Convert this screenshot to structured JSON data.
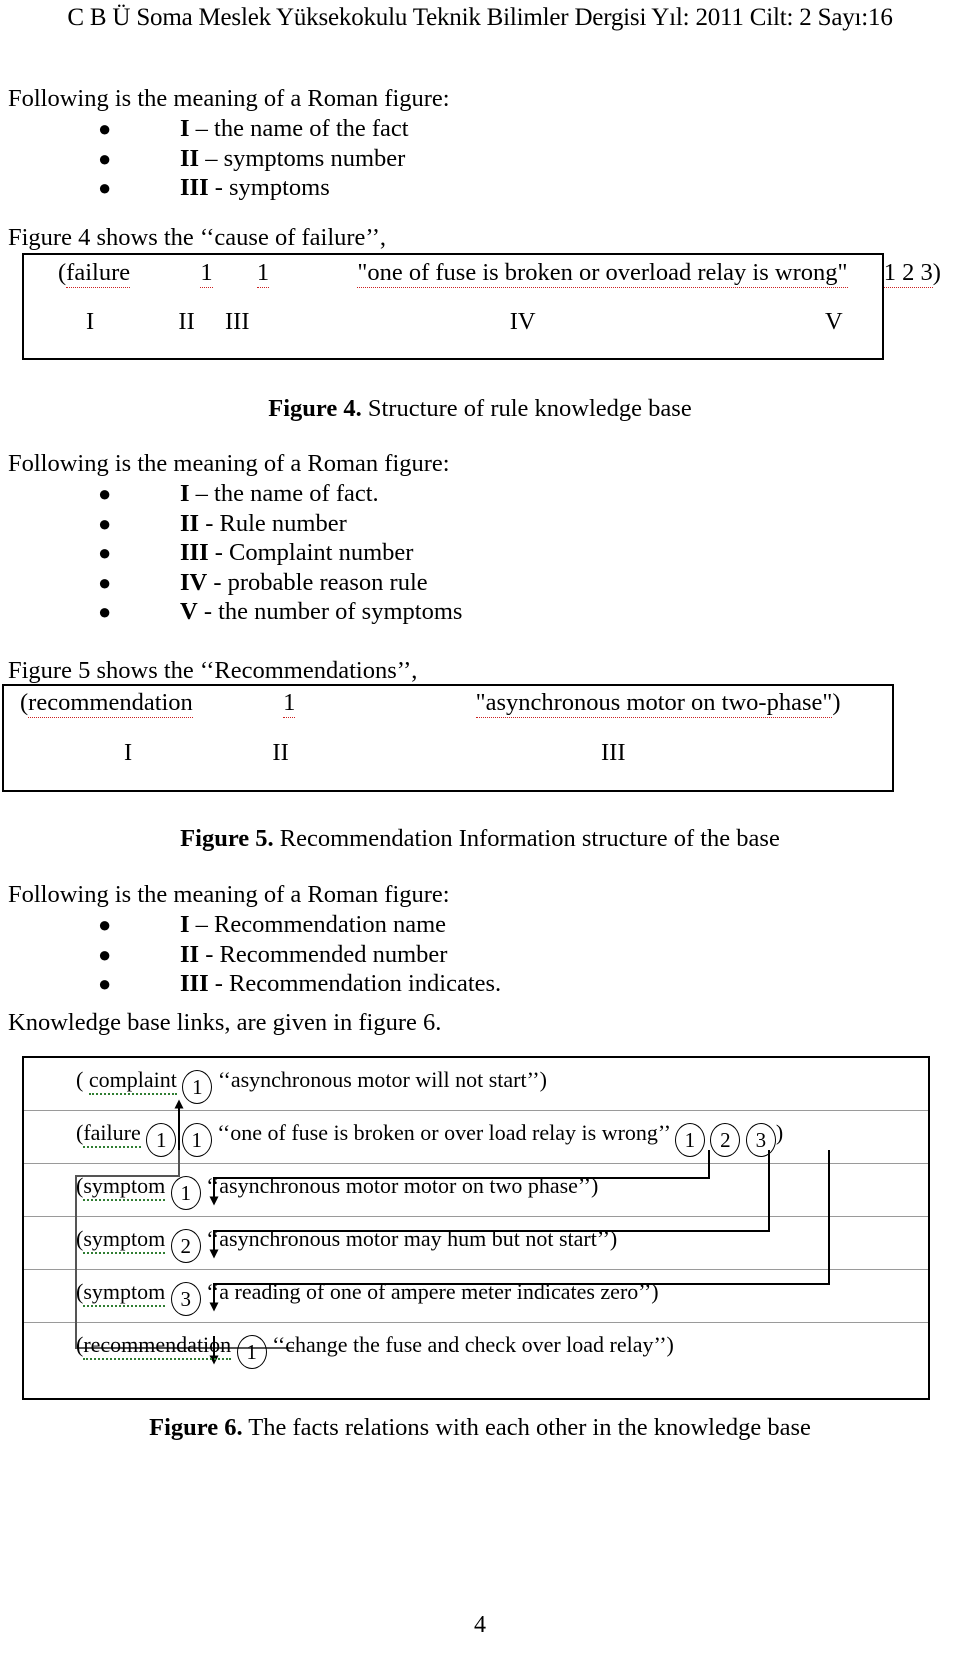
{
  "header": {
    "running_head": "C B Ü Soma Meslek Yüksekokulu Teknik Bilimler Dergisi Yıl: 2011 Cilt: 2 Sayı:16"
  },
  "section_fig4": {
    "intro": "Following is the meaning of a Roman figure:",
    "bullets": [
      {
        "roman": "I",
        "text": " – the name of the fact"
      },
      {
        "roman": "II",
        "text": " – symptoms number"
      },
      {
        "roman": "III",
        "text": " - symptoms"
      }
    ],
    "lead_in": "Figure 4 shows the ‘‘cause of failure’’,",
    "box": {
      "open_paren": "(",
      "fact_name": "failure",
      "rule_number": "1",
      "complaint_number": "1",
      "quoted": "\"one of fuse is broken or overload relay is wrong\"",
      "symptom_numbers": "1 2 3",
      "close_paren": ")",
      "roman_labels": [
        "I",
        "II",
        "III",
        "IV",
        "V"
      ]
    },
    "caption_bold": "Figure 4.",
    "caption_rest": " Structure of rule knowledge base"
  },
  "section_fig5": {
    "intro": "Following is the meaning of a Roman figure:",
    "bullets": [
      {
        "roman": "I",
        "text": " – the name of fact."
      },
      {
        "roman": "II",
        "text": " - Rule number"
      },
      {
        "roman": "III",
        "text": " - Complaint number"
      },
      {
        "roman": "IV",
        "text": " -  probable reason rule"
      },
      {
        "roman": "V",
        "text": " - the number of symptoms"
      }
    ],
    "lead_in": "Figure 5 shows the ‘‘Recommendations’’,",
    "box": {
      "open_paren": "(",
      "fact_name": "recommendation",
      "recommended_number": "1",
      "quoted": "\"asynchronous motor on two-phase\"",
      "close_paren": ")",
      "roman_labels": [
        "I",
        "II",
        "III"
      ]
    },
    "caption_bold": "Figure 5.",
    "caption_rest": " Recommendation Information structure of the base"
  },
  "section_fig6": {
    "intro": "Following is the meaning of a Roman figure:",
    "bullets": [
      {
        "roman": "I",
        "text": " – Recommendation name"
      },
      {
        "roman": "II",
        "text": " - Recommended number"
      },
      {
        "roman": "III",
        "text": " - Recommendation indicates."
      }
    ],
    "lead_in": "Knowledge base links, are given in figure 6.",
    "diagram": {
      "rows": [
        {
          "open_paren": "(",
          "fact": "complaint",
          "index": "1",
          "quoted": "‘‘asynchronous motor will not start’’",
          "close_paren": ")",
          "refs": []
        },
        {
          "open_paren": "(",
          "fact": "failure",
          "index": "1",
          "index2": "1",
          "quoted": "‘‘one of fuse is broken or over load relay is wrong’’",
          "close_paren": ")",
          "refs": [
            "1",
            "2",
            "3"
          ]
        },
        {
          "open_paren": "(",
          "fact": "symptom",
          "index": "1",
          "quoted": "‘‘asynchronous motor motor on two phase’’",
          "close_paren": ")",
          "refs": []
        },
        {
          "open_paren": "(",
          "fact": "symptom",
          "index": "2",
          "quoted": "‘‘asynchronous motor may hum but not start’’",
          "close_paren": ")",
          "refs": []
        },
        {
          "open_paren": "(",
          "fact": "symptom",
          "index": "3",
          "quoted": "‘‘a reading of one of ampere meter indicates zero’’",
          "close_paren": ")",
          "refs": []
        },
        {
          "open_paren": "(",
          "fact": "recommendation",
          "index": "1",
          "quoted": "‘‘change the fuse and check over load relay’’",
          "close_paren": ")",
          "refs": []
        }
      ]
    },
    "caption_bold": "Figure 6.",
    "caption_rest": " The facts relations with each other in the knowledge base"
  },
  "footer": {
    "page_number": "4"
  }
}
